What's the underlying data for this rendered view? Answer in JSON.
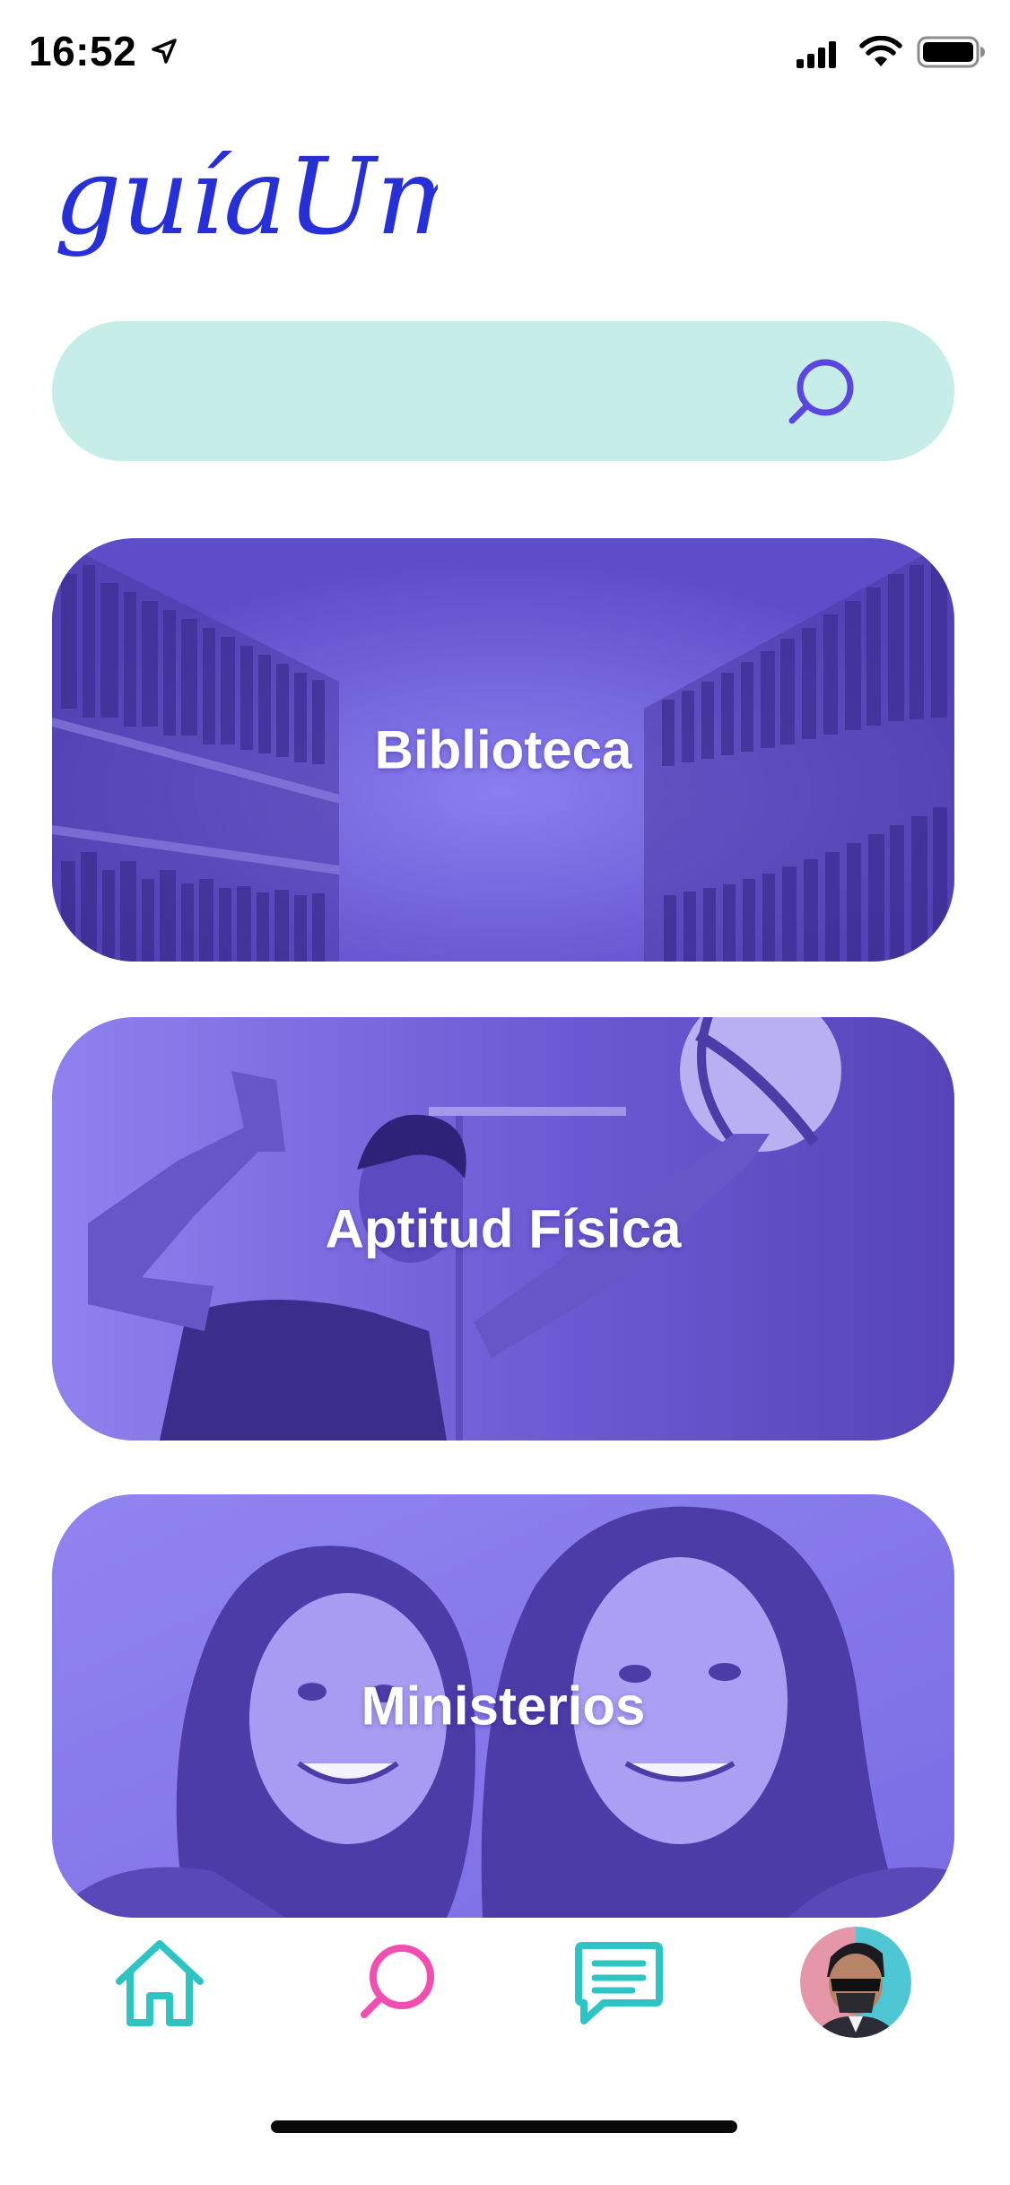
{
  "status_bar": {
    "time": "16:52",
    "location_icon": "location-arrow-icon",
    "signal_icon": "cellular-signal-icon",
    "wifi_icon": "wifi-icon",
    "battery_icon": "battery-icon"
  },
  "logo": {
    "text": "guíaUm",
    "color": "#2730d6"
  },
  "search": {
    "value": "",
    "placeholder": "",
    "icon": "search-icon",
    "background": "#c6ede7",
    "icon_color": "#5b47e0"
  },
  "cards": [
    {
      "title": "Biblioteca",
      "color": "#6f5ed6"
    },
    {
      "title": "Aptitud Física",
      "color": "#6a58d0"
    },
    {
      "title": "Ministerios",
      "color": "#8578ea"
    }
  ],
  "bottom_nav": {
    "items": [
      {
        "icon": "home-icon",
        "color": "#2ec4c4"
      },
      {
        "icon": "search-icon",
        "color": "#f04eb0"
      },
      {
        "icon": "chat-icon",
        "color": "#2ec4c4"
      },
      {
        "icon": "avatar"
      }
    ]
  }
}
